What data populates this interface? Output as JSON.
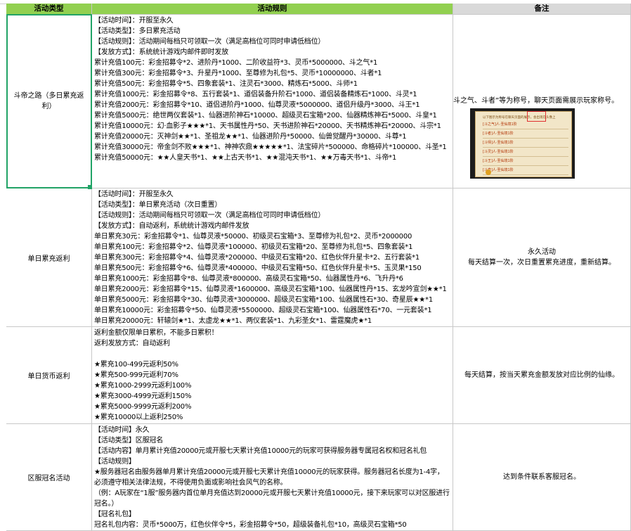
{
  "headers": {
    "type": "活动类型",
    "rules": "活动规则",
    "notes": "备注"
  },
  "rows": [
    {
      "type": "斗帝之路（多日累充返利）",
      "rules": [
        "【活动时间】：开服至永久",
        "【活动类型】：多日累充活动",
        "【活动规则】：活动期间每档只可领取一次（满足高档位可同时申请低档位）",
        "【发放方式】：系统统计游戏内邮件即时发放",
        "累计充值100元：彩金招募令*2、进阶丹*1000、二阶收益符*3、灵币*5000000、斗之气*1",
        "累计充值300元：彩金招募令*3、升星丹*1000、至尊修为礼包*5、灵币*10000000、斗者*1",
        "累计充值500元：彩金招募令*5、四象套装*1、注灵石*3000、精炼石*5000、斗师*1",
        "累计充值1000元：彩金招募令*8、五行套装*1、道侣装备升阶石*1000、道侣装备精炼石*1000、斗灵*1",
        "累计充值2000元：彩金招募令*10、道侣进阶丹*1000、仙尊灵液*5000000、道侣升级丹*3000、斗王*1",
        "累计充值5000元：绝世两仪套装*1、仙器进阶神石*10000、超级灵石宝箱*200、仙器精炼神石*5000、斗皇*1",
        "累计充值10000元：幻·血影子★★★*1、天书属性丹*50、天书进阶神石*20000、天书精炼神石*20000、斗宗*1",
        "累计充值20000元：灭神剑★★*1、圣祖龙★★*1、仙器进阶丹*50000、仙兽觉醒丹*30000、斗尊*1",
        "累计充值30000元：帝金剑不败★★★*1、神神农鼎★★★★★*1、法宝碎片*500000、命格碎片*100000、斗圣*1",
        "累计充值50000元：★★人皇天书*1、★★上古天书*1、★★混沌天书*1、★★万毒天书*1、斗帝*1"
      ],
      "note": "斗之气、斗者”等为称号，聊天页面需展示玩家称号。",
      "thumb": {
        "header": "以下图示为称号在聊天页面的展示，会出现在头像上",
        "rows": [
          "[斗之气]人·圣仙境1阶",
          "[斗者]人·圣仙境1阶",
          "[斗师]人·圣仙境1阶",
          "[斗灵]人·圣仙境1阶",
          "[斗王]人·圣仙境1阶",
          "[斗皇]人·圣仙境1阶"
        ]
      }
    },
    {
      "type": "单日累充返利",
      "rules": [
        "【活动时间】：开服至永久",
        "【活动类型】：单日累充活动（次日重置）",
        "【活动规则】：活动期间每档只可领取一次（满足高档位可同时申请低档位）",
        "【发放方式】：自动返利，系统统计游戏内邮件发放",
        "单日累充30元：彩金招募令*1、仙尊灵液*50000、初级灵石宝箱*3、至尊修为礼包*2、灵币*2000000",
        "单日累充100元：彩金招募令*2、仙尊灵液*100000、初级灵石宝箱*20、至尊修为礼包*5、四象套装*1",
        "单日累充300元：彩金招募令*4、仙尊灵液*200000、中级灵石宝箱*20、红色伙伴升星卡*2、五行套装*1",
        "单日累充500元：彩金招募令*6、仙尊灵液*400000、中级灵石宝箱*50、红色伙伴升星卡*5、玉灵果*150",
        "单日累充1000元：彩金招募令*8、仙尊灵液*800000、高级灵石宝箱*50、仙器属性丹*6、飞升丹*6",
        "单日累充2000元：彩金招募令*15、仙尊灵液*1600000、高级灵石宝箱*100、仙器属性丹*15、玄龙吟宣剑★★*1",
        "单日累充5000元：彩金招募令*30、仙尊灵液*3000000、超级灵石宝箱*100、仙器属性石*30、奇星辰★★*1",
        "单日累充10000元：彩金招募令*50、仙尊灵液*5500000、超级灵石宝箱*100、仙器属性石*70、一元套装*1",
        "单日累充20000元：轩辕剑★*1、太虚龙★★*1、两仪套装*1、九彩圣女*1、雷霆魔虎★*1"
      ],
      "note": "永久活动\n每天结算一次，次日重置累充进度，重新结算。"
    },
    {
      "type": "单日货币返利",
      "rules": [
        "返利金额仅限单日累积，不能多日累积！",
        "返利发放方式：自动返利",
        "",
        "★累充100-499元返利50%",
        "★累充500-999元返利70%",
        "★累充1000-2999元返利100%",
        "★累充3000-4999元返利150%",
        "★累充5000-9999元返利200%",
        "★累充10000以上返利250%"
      ],
      "note": "每天结算，按当天累充金额发放对应比例的仙缘。"
    },
    {
      "type": "区服冠名活动",
      "rules": [
        "【活动时间】永久",
        "【活动类型】区服冠名",
        "【活动内容】单月累计充值20000元或开服七天累计充值10000元的玩家可获得服务器专属冠名权和冠名礼包",
        "【活动规则】",
        "★服务器冠名由服务器单月累计充值20000元或开服七天累计充值10000元的玩家获得。服务器冠名长度为1-4字，必须遵守相关法律法规，不得使用负面或影响社会风气的名称。",
        "（例：A玩家在“1服”服务器内首位单月充值达到20000元或开服七天累计充值10000元，接下来玩家可以对区服进行冠名。）",
        "【冠名礼包】",
        "冠名礼包内容：灵币*5000万，红色伙伴令*5，彩金招募令*50，超级装备礼包*10，高级灵石宝箱*50"
      ],
      "note": "达到条件联系客服冠名。"
    }
  ],
  "colors": {
    "header_green": "#92d050",
    "header_gray": "#d9d9d9",
    "selection": "#21a366",
    "grid": "#c8c8c8"
  }
}
